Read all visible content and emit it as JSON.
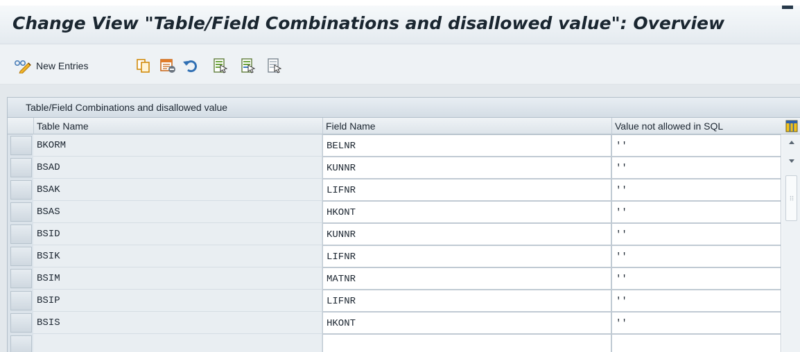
{
  "title": "Change View \"Table/Field Combinations and disallowed value\": Overview",
  "toolbar": {
    "new_entries_label": "New Entries",
    "icons": [
      "display-change-icon",
      "copy-as-icon",
      "delete-icon",
      "undo-change-icon",
      "select-all-icon",
      "select-block-icon",
      "deselect-all-icon"
    ]
  },
  "table": {
    "caption": "Table/Field Combinations and disallowed value",
    "columns": [
      "Table Name",
      "Field Name",
      "Value not allowed in SQL"
    ],
    "rows": [
      {
        "table": "BKORM",
        "field": "BELNR",
        "value": "''"
      },
      {
        "table": "BSAD",
        "field": "KUNNR",
        "value": "''"
      },
      {
        "table": "BSAK",
        "field": "LIFNR",
        "value": "''"
      },
      {
        "table": "BSAS",
        "field": "HKONT",
        "value": "''"
      },
      {
        "table": "BSID",
        "field": "KUNNR",
        "value": "''"
      },
      {
        "table": "BSIK",
        "field": "LIFNR",
        "value": "''"
      },
      {
        "table": "BSIM",
        "field": "MATNR",
        "value": "''"
      },
      {
        "table": "BSIP",
        "field": "LIFNR",
        "value": "''"
      },
      {
        "table": "BSIS",
        "field": "HKONT",
        "value": "''"
      },
      {
        "table": "",
        "field": "",
        "value": ""
      }
    ]
  },
  "colors": {
    "header_bg": "#e4eaef",
    "title_text": "#1a2630",
    "selector": "#cfd8e0"
  }
}
